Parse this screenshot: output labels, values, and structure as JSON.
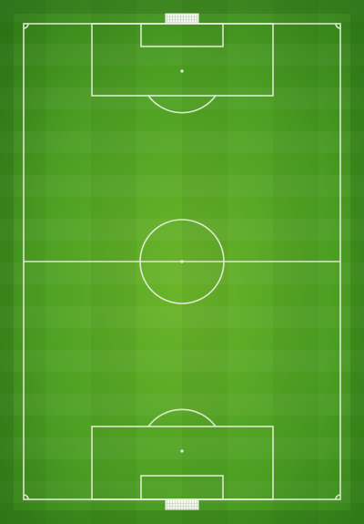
{
  "pitch": {
    "surface": "grass",
    "orientation": "vertical",
    "colors": {
      "grass_light": "#6cb52a",
      "grass_mid": "#4c9f23",
      "grass_dark": "#2f7a18",
      "line": "#e8f0dc"
    },
    "markings": [
      "outer-boundary",
      "halfway-line",
      "centre-circle",
      "centre-spot",
      "penalty-area-top",
      "goal-area-top",
      "penalty-spot-top",
      "penalty-arc-top",
      "penalty-area-bottom",
      "goal-area-bottom",
      "penalty-spot-bottom",
      "penalty-arc-bottom",
      "goal-top",
      "goal-bottom"
    ]
  }
}
